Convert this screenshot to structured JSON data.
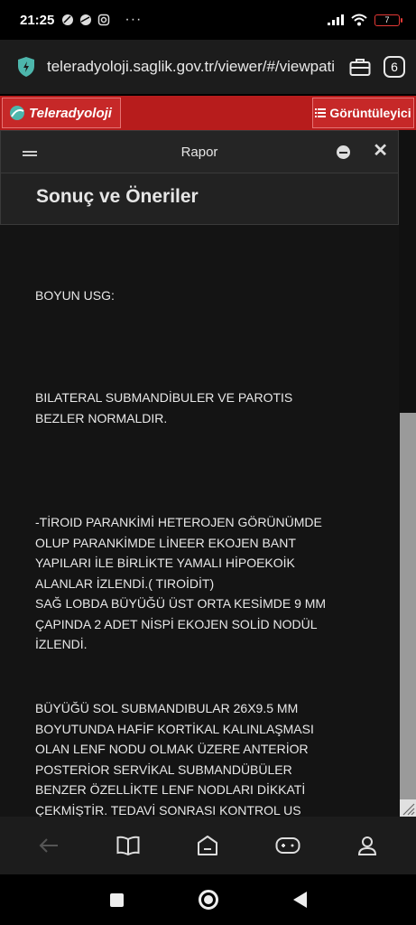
{
  "status_bar": {
    "time": "21:25",
    "battery": "7"
  },
  "browser": {
    "url": "teleradyoloji.saglik.gov.tr/viewer/#/viewpati",
    "tab_count": "6"
  },
  "app_header": {
    "logo": "Teleradyoloji",
    "viewer_label": "Görüntüleyici"
  },
  "panel": {
    "title": "Rapor",
    "section_title": "Sonuç ve Öneriler"
  },
  "report": {
    "paragraphs": [
      "BOYUN USG:",
      "BILATERAL SUBMANDİBULER VE PAROTIS\nBEZLER NORMALDIR.",
      "-TİROID PARANKİMİ HETEROJEN GÖRÜNÜMDE\nOLUP PARANKİMDE LİNEER EKOJEN BANT\nYAPILARI İLE BİRLİKTE YAMALI HİPOEKOİK\nALANLAR İZLENDİ.( TIROİDİT)\nSAĞ LOBDA BÜYÜĞÜ ÜST ORTA KESİMDE 9 MM\nÇAPINDA 2 ADET NİSPİ EKOJEN SOLİD NODÜL\nİZLENDİ.",
      "BÜYÜĞÜ SOL SUBMANDIBULAR 26X9.5 MM\nBOYUTUNDA  HAFİF KORTİKAL KALINLAŞMASI\nOLAN LENF NODU OLMAK ÜZERE ANTERİOR\nPOSTERİOR SERVİKAL SUBMANDÜBÜLER\nBENZER ÖZELLİKTE LENF NODLARI DİKKATİ\nÇEKMİŞTİR. TEDAVİ SONRASI KONTROL US"
    ]
  },
  "colors": {
    "brand_red": "#b71c1c",
    "background": "#141414"
  }
}
